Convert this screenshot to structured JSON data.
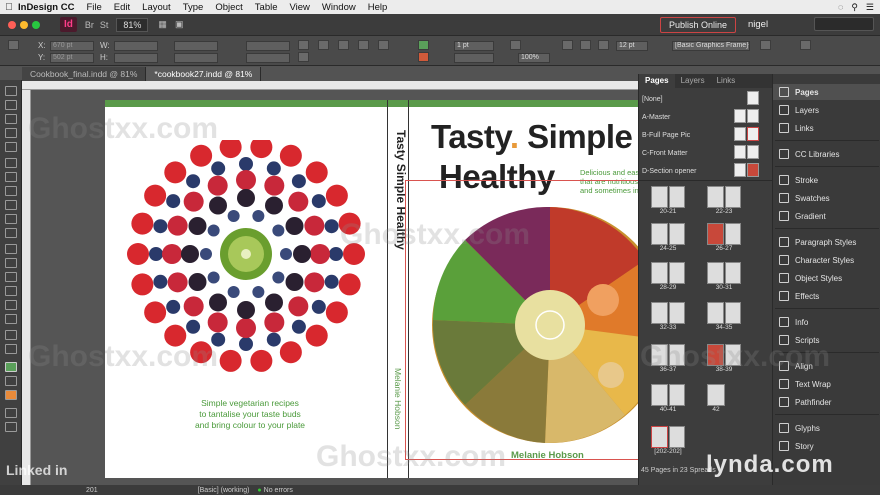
{
  "menubar": {
    "app_name": "InDesign CC",
    "items": [
      "File",
      "Edit",
      "Layout",
      "Type",
      "Object",
      "Table",
      "View",
      "Window",
      "Help"
    ]
  },
  "appbar": {
    "logo": "Id",
    "zoom": "81%",
    "publish": "Publish Online",
    "user": "nigel"
  },
  "control": {
    "x_label": "X:",
    "y_label": "Y:",
    "w_label": "W:",
    "h_label": "H:",
    "x_value": "670 pt",
    "y_value": "502 pt",
    "stroke_weight": "1 pt",
    "opacity": "100%",
    "spacing": "12 pt",
    "frame_style": "[Basic Graphics Frame]+"
  },
  "tabs": [
    {
      "label": "Cookbook_final.indd @ 81%"
    },
    {
      "label": "*cookbook27.indd @ 81%"
    }
  ],
  "document": {
    "spine_title": "Tasty Simple Healthy",
    "spine_author": "Melanie Hobson",
    "back_blurb_1": "Simple vegetarian recipes",
    "back_blurb_2": "to tantalise your taste buds",
    "back_blurb_3": "and bring colour to your plate",
    "title_word1": "Tasty",
    "title_word2": "Simple",
    "title_word3": "Healthy",
    "title_dot": ".",
    "tagline_1": "Delicious and easy",
    "tagline_2": "that are nutritious",
    "tagline_3": "and sometimes ind",
    "front_author": "Melanie Hobson"
  },
  "pages_panel": {
    "tabs": [
      "Pages",
      "Layers",
      "Links"
    ],
    "masters": [
      "[None]",
      "A-Master",
      "B-Full Page Pic",
      "C-Front Matter",
      "D-Section opener"
    ],
    "spreads": [
      "20-21",
      "22-23",
      "24-25",
      "26-27",
      "28-29",
      "30-31",
      "32-33",
      "34-35",
      "36-37",
      "38-39",
      "40-41",
      "42",
      "[202-202]"
    ],
    "status": "45 Pages in 23 Spreads"
  },
  "dock": {
    "items": [
      "Pages",
      "Layers",
      "Links",
      "CC Libraries",
      "Stroke",
      "Swatches",
      "Gradient",
      "Paragraph Styles",
      "Character Styles",
      "Object Styles",
      "Effects",
      "Info",
      "Scripts",
      "Align",
      "Text Wrap",
      "Pathfinder",
      "Glyphs",
      "Story"
    ]
  },
  "statusbar": {
    "page": "201",
    "style": "[Basic] (working)",
    "errors": "No errors"
  },
  "watermarks": {
    "linkedin": "Linked in",
    "lynda": "lynda.com",
    "ghost": "Ghostxx.com"
  },
  "colors": {
    "accent_green": "#5a9a4a",
    "title_dot": "#e89a3a",
    "frame_red": "#d9534f"
  }
}
